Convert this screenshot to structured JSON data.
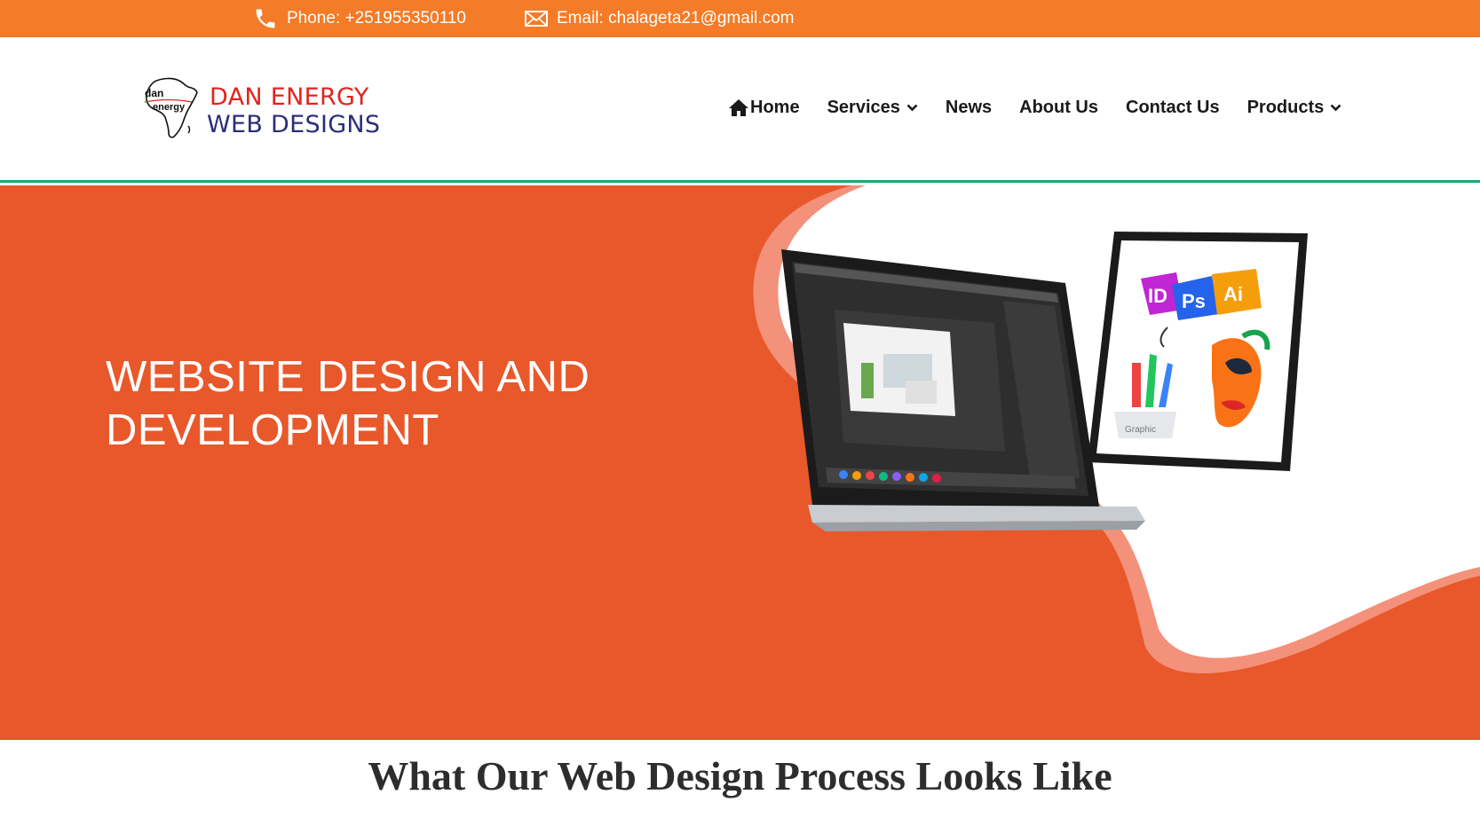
{
  "topbar": {
    "phone": "Phone: +251955350110",
    "email": "Email: chalageta21@gmail.com",
    "background": "#f47b27"
  },
  "logo": {
    "mark_top": "dan",
    "mark_bottom": "energy",
    "line1": "DAN ENERGY",
    "line2": "WEB DESIGNS"
  },
  "nav": {
    "items": [
      {
        "label": "Home",
        "icon": "home-icon"
      },
      {
        "label": "Services",
        "icon": "chevron-down-icon"
      },
      {
        "label": "News"
      },
      {
        "label": "About Us"
      },
      {
        "label": "Contact Us"
      },
      {
        "label": "Products",
        "icon": "chevron-down-icon"
      }
    ]
  },
  "hero": {
    "title": "WEBSITE DESIGN AND DEVELOPMENT",
    "background": "#e8582b",
    "tablet_badges": [
      "ID",
      "Ps",
      "Ai"
    ],
    "tablet_caption": "Graphic"
  },
  "section": {
    "title": "What Our Web Design Process Looks Like"
  }
}
